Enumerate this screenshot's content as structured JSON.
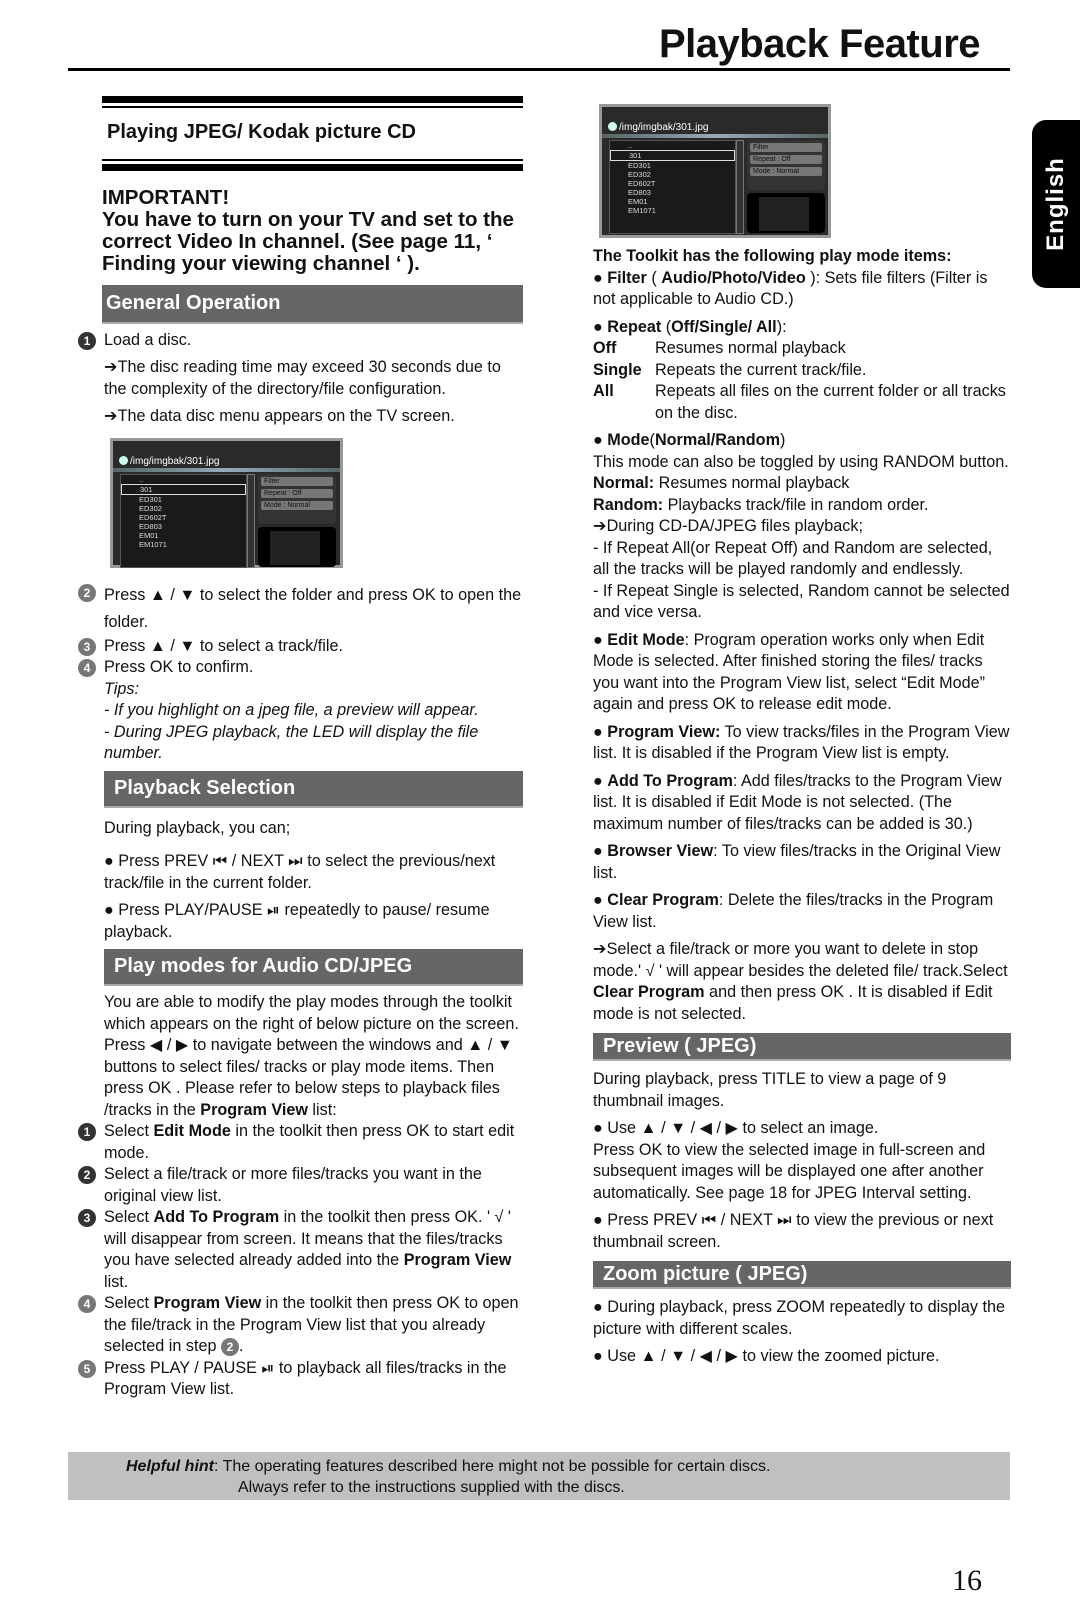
{
  "header": {
    "title": "Playback Feature",
    "language_tab": "English"
  },
  "left": {
    "subtitle": "Playing JPEG/ Kodak picture CD",
    "important_heading": "IMPORTANT!",
    "important_text": "You have to turn on your TV and set to the correct Video In channel. (See page 11, ‘ Finding your viewing channel ‘ ).",
    "general_operation": {
      "heading": "General Operation",
      "step1": "Load a disc.",
      "note1": "➔The disc reading time may exceed 30 seconds due to the complexity of the directory/file configuration.",
      "note2": "➔The data disc menu appears on the TV screen.",
      "step2": "Press ▲ / ▼ to select the folder and press OK to open the folder.",
      "step3": "Press ▲ / ▼ to select a track/file.",
      "step4": "Press OK to confirm.",
      "tips_label": "Tips:",
      "tip1": "- If you highlight on a jpeg file, a preview will appear.",
      "tip2": "- During JPEG playback, the LED will display the file number."
    },
    "playback_selection": {
      "heading": "Playback Selection",
      "intro": "During playback, you can;",
      "bullet1": "● Press PREV ⏮ / NEXT ⏭ to select the previous/next track/file in the current folder.",
      "bullet2": "● Press PLAY/PAUSE ⏯ repeatedly to pause/ resume playback."
    },
    "play_modes": {
      "heading": "Play modes for Audio CD/JPEG",
      "intro": "You are able to modify the play modes through the toolkit which appears on the right of below picture on the screen. Press ◀ / ▶ to navigate between the windows and ▲ / ▼ buttons to select files/ tracks or play mode items. Then press OK . Please refer to below steps to playback files /tracks in the ",
      "intro_bold": "Program View",
      "intro_end": " list:",
      "s1a": "Select ",
      "s1b": "Edit Mode",
      "s1c": " in the toolkit then press OK to start edit mode.",
      "s2": "Select a file/track or more files/tracks you want in the original view list.",
      "s3a": "Select ",
      "s3b": "Add To Program",
      "s3c": " in the toolkit then press OK. ' √ ' will disappear from screen. It means that the files/tracks you have selected already added into the ",
      "s3d": "Program View",
      "s3e": " list.",
      "s4a": "Select ",
      "s4b": "Program View",
      "s4c": " in the toolkit then press OK to open the file/track in the Program View list  that you already selected in step ",
      "s4d": "2",
      "s4e": ".",
      "s5": "Press PLAY / PAUSE ⏯ to playback all files/tracks in the Program View list."
    }
  },
  "screen": {
    "path": "/img/imgbak/301.jpg",
    "files": [
      "..",
      "301",
      "ED301",
      "ED302",
      "ED602T",
      "ED803",
      "EM01",
      "EM1071"
    ],
    "toolkit": [
      "Filter",
      "Repeat   : Off",
      "Mode   : Normal"
    ]
  },
  "right": {
    "toolkit_heading": "The Toolkit has the following play mode items:",
    "filter_b": "Filter",
    "filter_p1": " ( ",
    "filter_b2": "Audio/Photo/Video",
    "filter_p2": " ): Sets file filters (Filter is not applicable to Audio CD.)",
    "repeat_b": "Repeat",
    "repeat_b2": "Off/Single/ All",
    "off_k": "Off",
    "off_v": "Resumes normal playback",
    "single_k": "Single",
    "single_v": "Repeats the current track/file.",
    "all_k": "All",
    "all_v": "Repeats all files on the current folder or all tracks on the disc.",
    "mode_b": "Mode",
    "mode_b2": "Normal/Random",
    "mode_text": "This mode can also be toggled by using RANDOM button.",
    "normal_k": "Normal:",
    "normal_v": " Resumes normal playback",
    "random_k": "Random:",
    "random_v": " Playbacks track/file in random order.",
    "during": "➔During CD-DA/JPEG files playback;",
    "during1": "- If Repeat All(or Repeat Off) and Random are selected, all the tracks will be played randomly and endlessly.",
    "during2": "- If Repeat Single is selected, Random cannot be selected and vice versa.",
    "edit_b": "Edit Mode",
    "edit_v": ": Program operation  works only when Edit Mode is selected. After finished storing the files/ tracks you want into the Program View list, select “Edit Mode” again and press OK to release edit mode.",
    "pview_b": "Program View:",
    "pview_v": "  To view tracks/files in the Program View list. It is disabled if the Program View list is empty.",
    "add_b": "Add To Program",
    "add_v": ": Add files/tracks to the Program View list. It is disabled if Edit Mode is not selected. (The maximum number of files/tracks can be added is 30.)",
    "browser_b": "Browser View",
    "browser_v": ": To view files/tracks in the Original View list.",
    "clear_b": "Clear Program",
    "clear_v": ": Delete the files/tracks in the Program View list.",
    "clear_note_a": "➔Select a file/track or more you want to delete in stop mode.' √ ' will appear besides the deleted file/ track.Select ",
    "clear_note_b": "Clear Program",
    "clear_note_c": " and then press OK . It is disabled if Edit mode is not selected.",
    "preview": {
      "heading": "Preview ( JPEG)",
      "p1": "During playback, press TITLE to view a page of 9 thumbnail images.",
      "p2": "● Use ▲ / ▼ / ◀ / ▶ to select an image.",
      "p3": "Press OK to view the selected image in full-screen and subsequent images will be displayed one after another automatically. See page 18 for JPEG Interval setting.",
      "p4": "● Press PREV ⏮ / NEXT ⏭ to view the previous or next thumbnail screen."
    },
    "zoom": {
      "heading": "Zoom picture ( JPEG)",
      "p1": "● During playback, press ZOOM repeatedly to display the picture with different scales.",
      "p2": "● Use ▲ / ▼ / ◀ / ▶ to view the zoomed picture."
    }
  },
  "footer": {
    "hint_label": "Helpful hint",
    "hint_colon": ": ",
    "hint_line1": "The operating features described here might not be possible for certain discs.",
    "hint_line2": "Always refer to the instructions  supplied with the discs.",
    "page_number": "16"
  }
}
